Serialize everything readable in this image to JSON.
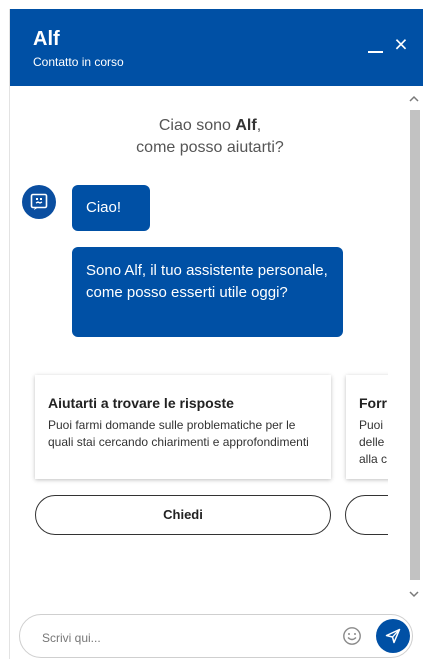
{
  "header": {
    "title": "Alf",
    "subtitle": "Contatto in corso",
    "minimize_icon": "minimize-icon",
    "close_label": "×",
    "close_icon": "close-icon",
    "background_color": "#0050a5"
  },
  "welcome": {
    "line1_prefix": "Ciao sono ",
    "line1_name": "Alf",
    "line1_suffix": ",",
    "line2": "come posso aiutarti?"
  },
  "messages": [
    {
      "text": "Ciao!"
    },
    {
      "text": "Sono Alf, il tuo assistente personale, come posso esserti utile oggi?"
    }
  ],
  "cards": [
    {
      "title": "Aiutarti a trovare le risposte",
      "description": "Puoi farmi domande sulle problematiche per le quali stai cercando chiarimenti e approfondimenti",
      "button": "Chiedi"
    },
    {
      "title": "Forr",
      "description": "Puoi delle alla c",
      "button": ""
    }
  ],
  "input": {
    "placeholder": "Scrivi qui..."
  },
  "icons": {
    "bot_avatar": "robot-icon",
    "emoji": "emoji-icon",
    "send": "send-icon",
    "scroll_up": "chevron-up-icon",
    "scroll_down": "chevron-down-icon"
  }
}
